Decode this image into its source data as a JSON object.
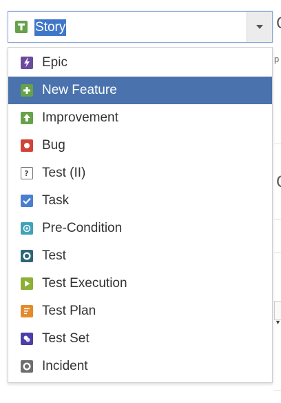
{
  "issue_type_select": {
    "selected_label": "Story",
    "selected_icon": "story-icon",
    "selected_icon_color": "#65a249"
  },
  "menu": {
    "items": [
      {
        "label": "Epic",
        "icon": "epic-icon",
        "color": "#6b4b9f"
      },
      {
        "label": "New Feature",
        "icon": "new-feature-icon",
        "color": "#65a249"
      },
      {
        "label": "Improvement",
        "icon": "improvement-icon",
        "color": "#65a249"
      },
      {
        "label": "Bug",
        "icon": "bug-icon",
        "color": "#d04437"
      },
      {
        "label": "Test (II)",
        "icon": "question-icon",
        "color": "#707070"
      },
      {
        "label": "Task",
        "icon": "checkbox-icon",
        "color": "#4a7fd0"
      },
      {
        "label": "Pre-Condition",
        "icon": "pre-condition-icon",
        "color": "#3fa2b8"
      },
      {
        "label": "Test",
        "icon": "test-icon",
        "color": "#2d6678"
      },
      {
        "label": "Test Execution",
        "icon": "play-icon",
        "color": "#8bb035"
      },
      {
        "label": "Test Plan",
        "icon": "document-icon",
        "color": "#e38b2c"
      },
      {
        "label": "Test Set",
        "icon": "test-set-icon",
        "color": "#4c3fa8"
      },
      {
        "label": "Incident",
        "icon": "incident-icon",
        "color": "#6e6e6e"
      }
    ],
    "highlighted_index": 1
  }
}
